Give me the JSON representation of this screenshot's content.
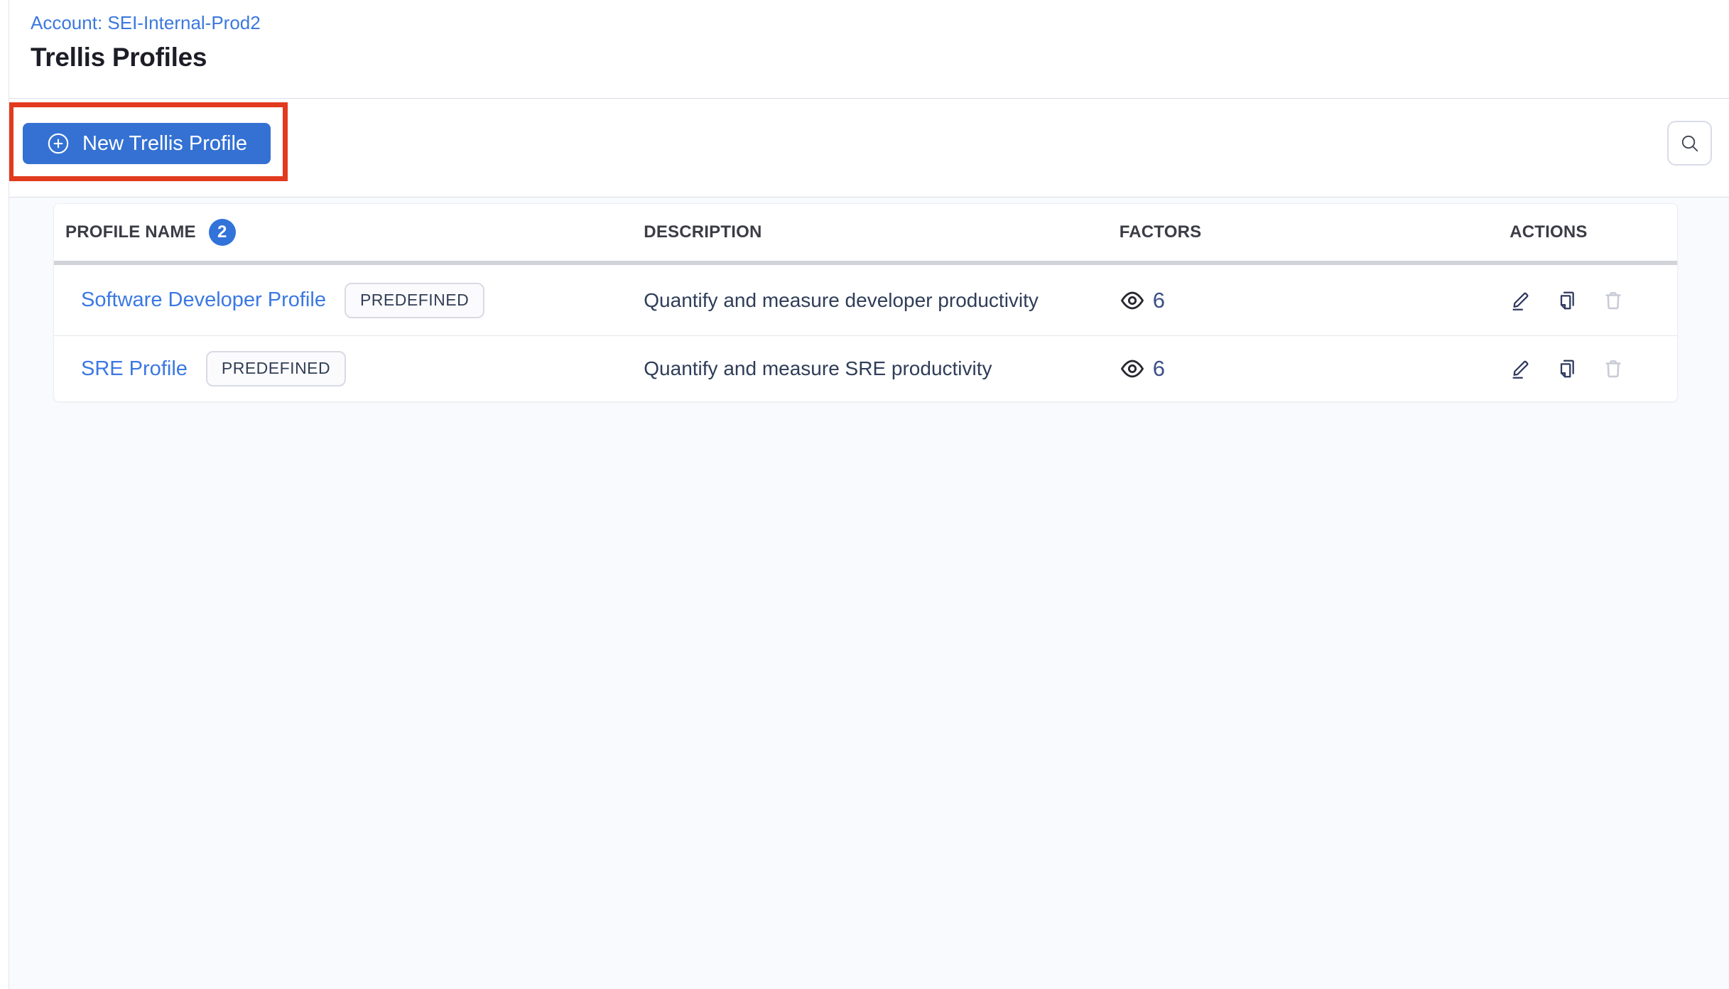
{
  "page": {
    "account_label": "Account: SEI-Internal-Prod2",
    "title": "Trellis Profiles"
  },
  "toolbar": {
    "new_profile_button_label": "New Trellis Profile",
    "search_icon": "search-icon",
    "annotation": "red-highlight-rectangle-around-new-profile-button"
  },
  "table": {
    "columns": [
      {
        "label": "PROFILE NAME",
        "count_badge": "2"
      },
      {
        "label": "DESCRIPTION"
      },
      {
        "label": "FACTORS"
      },
      {
        "label": "ACTIONS"
      }
    ],
    "rows": [
      {
        "name": "Software Developer Profile",
        "tag": "PREDEFINED",
        "description": "Quantify and measure developer productivity",
        "factors_count": "6",
        "actions": [
          "edit",
          "copy",
          "delete"
        ]
      },
      {
        "name": "SRE Profile",
        "tag": "PREDEFINED",
        "description": "Quantify and measure SRE productivity",
        "factors_count": "6",
        "actions": [
          "edit",
          "copy",
          "delete"
        ]
      }
    ]
  },
  "colors": {
    "primary_button_blue": "#3471d3",
    "link_blue": "#3b78dd",
    "count_badge_blue": "#3273da",
    "annotation_red": "#e23a1e",
    "icon_navy": "#2e3960",
    "icon_dark": "#27272f",
    "icon_disabled_gray": "#c9cbd5",
    "icon_search_gray": "#41434f",
    "plus_icon_white": "#ffffff",
    "content_background": "#f9fafd"
  }
}
